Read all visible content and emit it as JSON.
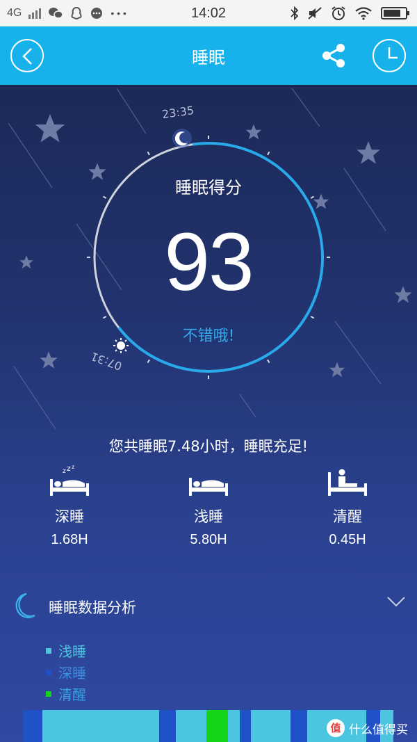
{
  "status_bar": {
    "network": "4G",
    "time": "14:02"
  },
  "header": {
    "title": "睡眠",
    "back_icon": "chevron-left-icon",
    "share_icon": "share-icon",
    "history_icon": "clock-icon"
  },
  "score_dial": {
    "start_time": "23:35",
    "end_time": "07:31",
    "label": "睡眠得分",
    "score": "93",
    "comment": "不错哦!"
  },
  "summary": "您共睡眠7.48小时，睡眠充足!",
  "stages": [
    {
      "name": "深睡",
      "value": "1.68H",
      "icon": "deep-sleep-bed-icon"
    },
    {
      "name": "浅睡",
      "value": "5.80H",
      "icon": "light-sleep-bed-icon"
    },
    {
      "name": "清醒",
      "value": "0.45H",
      "icon": "awake-bed-icon"
    }
  ],
  "analysis": {
    "title": "睡眠数据分析",
    "icon": "moon-icon",
    "toggle_icon": "chevron-down-icon"
  },
  "legend": [
    {
      "label": "浅睡",
      "color": "#4cc6e0"
    },
    {
      "label": "深睡",
      "color": "#1f52c7"
    },
    {
      "label": "清醒",
      "color": "#14d41a"
    }
  ],
  "timeline": [
    {
      "stage": "深睡",
      "fraction": 0.052
    },
    {
      "stage": "浅睡",
      "fraction": 0.315
    },
    {
      "stage": "深睡",
      "fraction": 0.045
    },
    {
      "stage": "浅睡",
      "fraction": 0.083
    },
    {
      "stage": "清醒",
      "fraction": 0.058
    },
    {
      "stage": "浅睡",
      "fraction": 0.032
    },
    {
      "stage": "深睡",
      "fraction": 0.03
    },
    {
      "stage": "浅睡",
      "fraction": 0.108
    },
    {
      "stage": "深睡",
      "fraction": 0.045
    },
    {
      "stage": "浅睡",
      "fraction": 0.158
    },
    {
      "stage": "深睡",
      "fraction": 0.038
    },
    {
      "stage": "浅睡",
      "fraction": 0.036
    }
  ],
  "watermark": {
    "text": "什么值得买",
    "badge": "值"
  },
  "colors": {
    "header_bg": "#17b2eb",
    "accent": "#34a8e8",
    "light_sleep": "#4cc6e0",
    "deep_sleep": "#1f52c7",
    "awake": "#14d41a"
  }
}
